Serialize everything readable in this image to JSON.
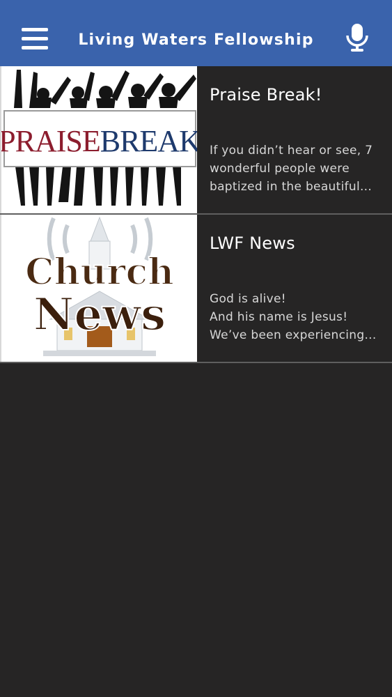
{
  "header": {
    "title": "Living Waters Fellowship",
    "menu_icon": "hamburger-menu-icon",
    "mic_icon": "microphone-icon",
    "background": "#3a63ac"
  },
  "feed": {
    "items": [
      {
        "title": "Praise Break!",
        "excerpt": "If you didn’t hear or see, 7\nwonderful people were\nbaptized in the beautiful...",
        "thumb_text": "PRAISEBREAK"
      },
      {
        "title": "LWF News",
        "excerpt": "God is alive!\nAnd his name is Jesus!\nWe’ve been experiencing...",
        "thumb_line1": "Church",
        "thumb_line2": "News"
      }
    ]
  }
}
